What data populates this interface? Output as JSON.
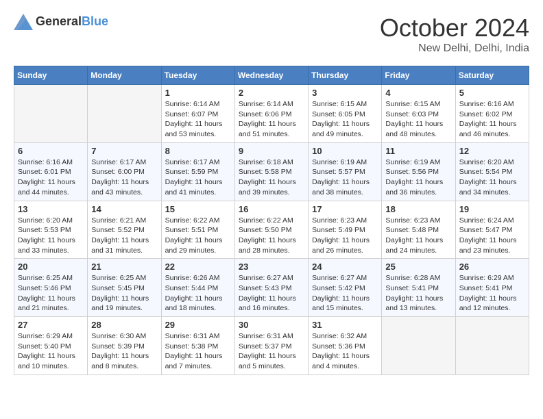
{
  "header": {
    "logo_general": "General",
    "logo_blue": "Blue",
    "month": "October 2024",
    "location": "New Delhi, Delhi, India"
  },
  "weekdays": [
    "Sunday",
    "Monday",
    "Tuesday",
    "Wednesday",
    "Thursday",
    "Friday",
    "Saturday"
  ],
  "weeks": [
    [
      {
        "day": "",
        "sunrise": "",
        "sunset": "",
        "daylight": ""
      },
      {
        "day": "",
        "sunrise": "",
        "sunset": "",
        "daylight": ""
      },
      {
        "day": "1",
        "sunrise": "Sunrise: 6:14 AM",
        "sunset": "Sunset: 6:07 PM",
        "daylight": "Daylight: 11 hours and 53 minutes."
      },
      {
        "day": "2",
        "sunrise": "Sunrise: 6:14 AM",
        "sunset": "Sunset: 6:06 PM",
        "daylight": "Daylight: 11 hours and 51 minutes."
      },
      {
        "day": "3",
        "sunrise": "Sunrise: 6:15 AM",
        "sunset": "Sunset: 6:05 PM",
        "daylight": "Daylight: 11 hours and 49 minutes."
      },
      {
        "day": "4",
        "sunrise": "Sunrise: 6:15 AM",
        "sunset": "Sunset: 6:03 PM",
        "daylight": "Daylight: 11 hours and 48 minutes."
      },
      {
        "day": "5",
        "sunrise": "Sunrise: 6:16 AM",
        "sunset": "Sunset: 6:02 PM",
        "daylight": "Daylight: 11 hours and 46 minutes."
      }
    ],
    [
      {
        "day": "6",
        "sunrise": "Sunrise: 6:16 AM",
        "sunset": "Sunset: 6:01 PM",
        "daylight": "Daylight: 11 hours and 44 minutes."
      },
      {
        "day": "7",
        "sunrise": "Sunrise: 6:17 AM",
        "sunset": "Sunset: 6:00 PM",
        "daylight": "Daylight: 11 hours and 43 minutes."
      },
      {
        "day": "8",
        "sunrise": "Sunrise: 6:17 AM",
        "sunset": "Sunset: 5:59 PM",
        "daylight": "Daylight: 11 hours and 41 minutes."
      },
      {
        "day": "9",
        "sunrise": "Sunrise: 6:18 AM",
        "sunset": "Sunset: 5:58 PM",
        "daylight": "Daylight: 11 hours and 39 minutes."
      },
      {
        "day": "10",
        "sunrise": "Sunrise: 6:19 AM",
        "sunset": "Sunset: 5:57 PM",
        "daylight": "Daylight: 11 hours and 38 minutes."
      },
      {
        "day": "11",
        "sunrise": "Sunrise: 6:19 AM",
        "sunset": "Sunset: 5:56 PM",
        "daylight": "Daylight: 11 hours and 36 minutes."
      },
      {
        "day": "12",
        "sunrise": "Sunrise: 6:20 AM",
        "sunset": "Sunset: 5:54 PM",
        "daylight": "Daylight: 11 hours and 34 minutes."
      }
    ],
    [
      {
        "day": "13",
        "sunrise": "Sunrise: 6:20 AM",
        "sunset": "Sunset: 5:53 PM",
        "daylight": "Daylight: 11 hours and 33 minutes."
      },
      {
        "day": "14",
        "sunrise": "Sunrise: 6:21 AM",
        "sunset": "Sunset: 5:52 PM",
        "daylight": "Daylight: 11 hours and 31 minutes."
      },
      {
        "day": "15",
        "sunrise": "Sunrise: 6:22 AM",
        "sunset": "Sunset: 5:51 PM",
        "daylight": "Daylight: 11 hours and 29 minutes."
      },
      {
        "day": "16",
        "sunrise": "Sunrise: 6:22 AM",
        "sunset": "Sunset: 5:50 PM",
        "daylight": "Daylight: 11 hours and 28 minutes."
      },
      {
        "day": "17",
        "sunrise": "Sunrise: 6:23 AM",
        "sunset": "Sunset: 5:49 PM",
        "daylight": "Daylight: 11 hours and 26 minutes."
      },
      {
        "day": "18",
        "sunrise": "Sunrise: 6:23 AM",
        "sunset": "Sunset: 5:48 PM",
        "daylight": "Daylight: 11 hours and 24 minutes."
      },
      {
        "day": "19",
        "sunrise": "Sunrise: 6:24 AM",
        "sunset": "Sunset: 5:47 PM",
        "daylight": "Daylight: 11 hours and 23 minutes."
      }
    ],
    [
      {
        "day": "20",
        "sunrise": "Sunrise: 6:25 AM",
        "sunset": "Sunset: 5:46 PM",
        "daylight": "Daylight: 11 hours and 21 minutes."
      },
      {
        "day": "21",
        "sunrise": "Sunrise: 6:25 AM",
        "sunset": "Sunset: 5:45 PM",
        "daylight": "Daylight: 11 hours and 19 minutes."
      },
      {
        "day": "22",
        "sunrise": "Sunrise: 6:26 AM",
        "sunset": "Sunset: 5:44 PM",
        "daylight": "Daylight: 11 hours and 18 minutes."
      },
      {
        "day": "23",
        "sunrise": "Sunrise: 6:27 AM",
        "sunset": "Sunset: 5:43 PM",
        "daylight": "Daylight: 11 hours and 16 minutes."
      },
      {
        "day": "24",
        "sunrise": "Sunrise: 6:27 AM",
        "sunset": "Sunset: 5:42 PM",
        "daylight": "Daylight: 11 hours and 15 minutes."
      },
      {
        "day": "25",
        "sunrise": "Sunrise: 6:28 AM",
        "sunset": "Sunset: 5:41 PM",
        "daylight": "Daylight: 11 hours and 13 minutes."
      },
      {
        "day": "26",
        "sunrise": "Sunrise: 6:29 AM",
        "sunset": "Sunset: 5:41 PM",
        "daylight": "Daylight: 11 hours and 12 minutes."
      }
    ],
    [
      {
        "day": "27",
        "sunrise": "Sunrise: 6:29 AM",
        "sunset": "Sunset: 5:40 PM",
        "daylight": "Daylight: 11 hours and 10 minutes."
      },
      {
        "day": "28",
        "sunrise": "Sunrise: 6:30 AM",
        "sunset": "Sunset: 5:39 PM",
        "daylight": "Daylight: 11 hours and 8 minutes."
      },
      {
        "day": "29",
        "sunrise": "Sunrise: 6:31 AM",
        "sunset": "Sunset: 5:38 PM",
        "daylight": "Daylight: 11 hours and 7 minutes."
      },
      {
        "day": "30",
        "sunrise": "Sunrise: 6:31 AM",
        "sunset": "Sunset: 5:37 PM",
        "daylight": "Daylight: 11 hours and 5 minutes."
      },
      {
        "day": "31",
        "sunrise": "Sunrise: 6:32 AM",
        "sunset": "Sunset: 5:36 PM",
        "daylight": "Daylight: 11 hours and 4 minutes."
      },
      {
        "day": "",
        "sunrise": "",
        "sunset": "",
        "daylight": ""
      },
      {
        "day": "",
        "sunrise": "",
        "sunset": "",
        "daylight": ""
      }
    ]
  ]
}
